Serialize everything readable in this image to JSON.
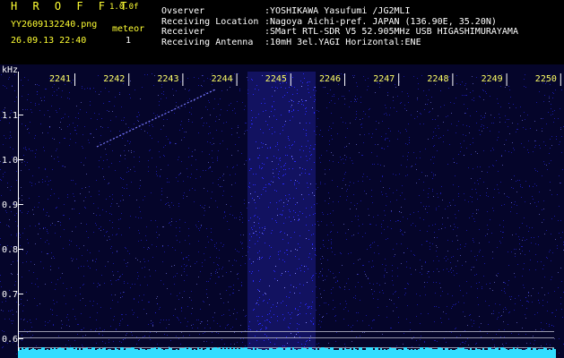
{
  "app": {
    "title": "H R O F F T",
    "version": "1.0.0f"
  },
  "file": {
    "name": "YY2609132240.png",
    "datetime": "26.09.13 22:40"
  },
  "counter": {
    "label": "meteor",
    "value": "1"
  },
  "station": [
    {
      "label": "Ovserver",
      "value": ":YOSHIKAWA Yasufumi /JG2MLI"
    },
    {
      "label": "Receiving Location",
      "value": ":Nagoya Aichi-pref. JAPAN (136.90E, 35.20N)"
    },
    {
      "label": "Receiver",
      "value": ":SMart RTL-SDR V5 52.905MHz USB HIGASHIMURAYAMA"
    },
    {
      "label": "Receiving Antenna",
      "value": ":10mH 3el.YAGI Horizontal:ENE"
    }
  ],
  "spectrogram": {
    "y_unit": "kHz",
    "y_ticks": [
      "1.1",
      "1.0",
      "0.9",
      "0.8",
      "0.7",
      "0.6"
    ],
    "time_ticks": [
      "2241",
      "2242",
      "2243",
      "2244",
      "2245",
      "2246",
      "2247",
      "2248",
      "2249",
      "2250"
    ],
    "colors": {
      "background": "#000000",
      "noise": "#2a2aff",
      "baseline": "#33ddff",
      "text": "#ffffff"
    }
  }
}
